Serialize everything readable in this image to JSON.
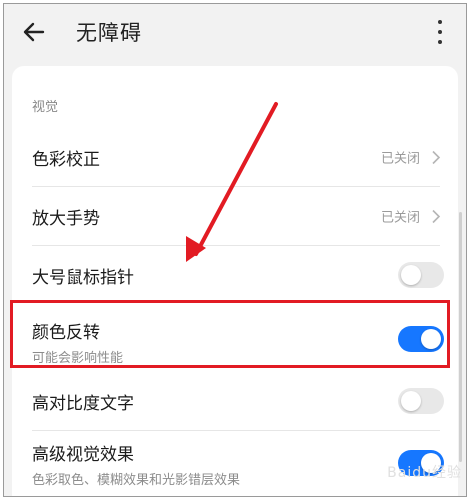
{
  "header": {
    "title": "无障碍"
  },
  "section": {
    "label": "视觉"
  },
  "settings": {
    "color_correction": {
      "label": "色彩校正",
      "status": "已关闭"
    },
    "magnify_gesture": {
      "label": "放大手势",
      "status": "已关闭"
    },
    "large_pointer": {
      "label": "大号鼠标指针",
      "enabled": false
    },
    "color_inversion": {
      "label": "颜色反转",
      "sublabel": "可能会影响性能",
      "enabled": true
    },
    "high_contrast": {
      "label": "高对比度文字",
      "enabled": false
    },
    "advanced_visual": {
      "label": "高级视觉效果",
      "sublabel": "色彩取色、模糊效果和光影错层效果",
      "enabled": true
    }
  },
  "watermark": {
    "text": "Baidu经验"
  },
  "colors": {
    "accent": "#1677ff",
    "highlight_box": "#e21b23",
    "arrow": "#e21b23",
    "toggle_off": "#e8e8e8"
  },
  "icons": [
    "back-arrow-icon",
    "more-vert-icon",
    "chevron-right-icon"
  ]
}
